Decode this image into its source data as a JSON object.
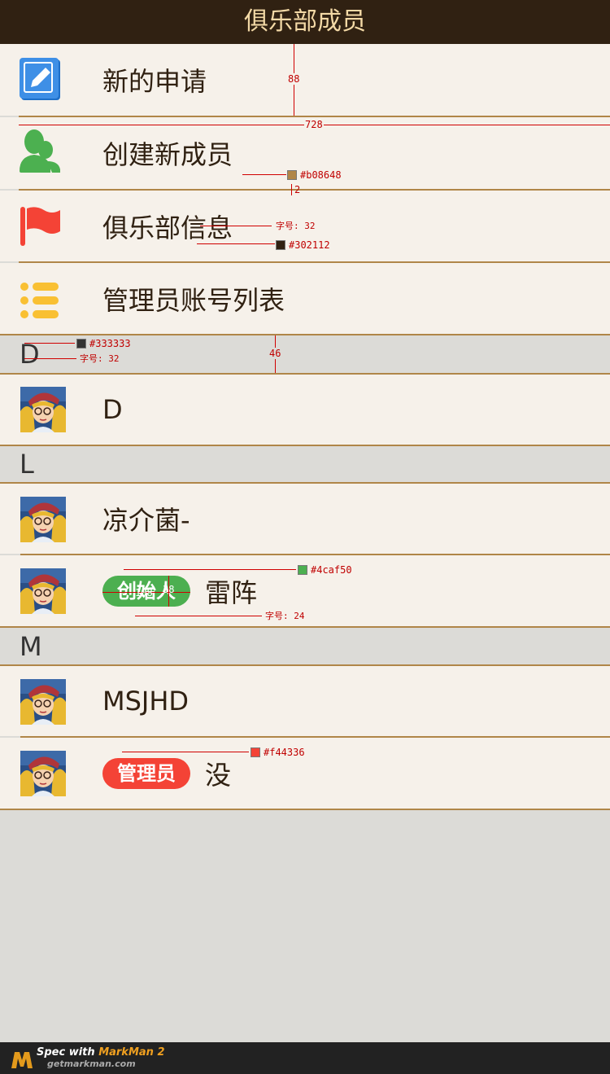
{
  "header": {
    "title": "俱乐部成员"
  },
  "menu": [
    {
      "label": "新的申请",
      "icon": "edit-icon"
    },
    {
      "label": "创建新成员",
      "icon": "user-icon"
    },
    {
      "label": "俱乐部信息",
      "icon": "flag-icon"
    },
    {
      "label": "管理员账号列表",
      "icon": "list-icon"
    }
  ],
  "sections": [
    {
      "letter": "D",
      "members": [
        {
          "name": "D"
        }
      ]
    },
    {
      "letter": "L",
      "members": [
        {
          "name": "凉介菌-"
        },
        {
          "name": "雷阵",
          "badge": "创始人"
        }
      ]
    },
    {
      "letter": "M",
      "members": [
        {
          "name": "MSJHD"
        },
        {
          "name": "没",
          "badge": "管理员"
        }
      ]
    }
  ],
  "annotations": {
    "row_height": "88",
    "row_width": "728",
    "divider_color": "#b08648",
    "divider_height": "2",
    "menu_font_size": "字号: 32",
    "text_color": "#302112",
    "section_color": "#333333",
    "section_font_size": "字号: 32",
    "section_height": "46",
    "founder_color": "#4caf50",
    "badge_width": "108",
    "badge_height": "38",
    "badge_font_size": "字号: 24",
    "admin_color": "#f44336"
  },
  "colors": {
    "header_bg": "#302112",
    "divider": "#b08648",
    "text": "#302112",
    "section_text": "#333333",
    "founder_badge": "#4caf50",
    "admin_badge": "#f44336"
  },
  "footer": {
    "line1": "Spec with",
    "line1_brand": "MarkMan 2",
    "line2": "getmarkman.com"
  }
}
